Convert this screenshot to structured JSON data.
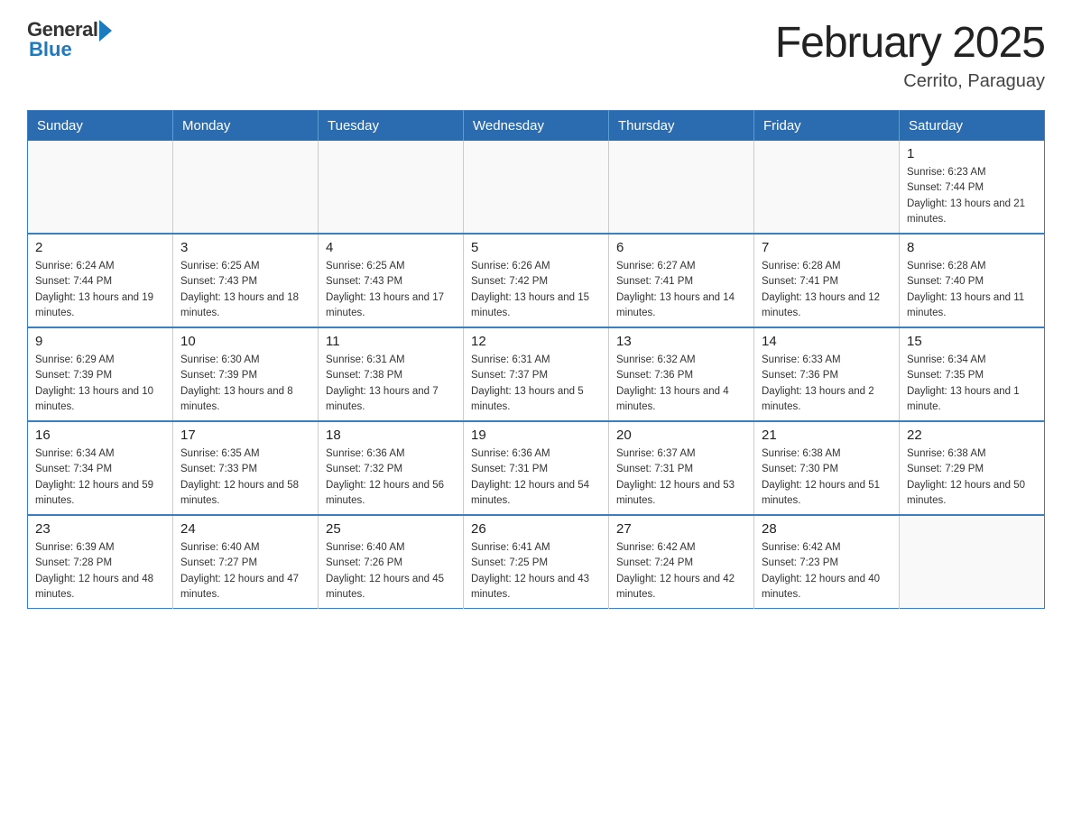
{
  "logo": {
    "general": "General",
    "blue": "Blue"
  },
  "title": "February 2025",
  "subtitle": "Cerrito, Paraguay",
  "days_of_week": [
    "Sunday",
    "Monday",
    "Tuesday",
    "Wednesday",
    "Thursday",
    "Friday",
    "Saturday"
  ],
  "weeks": [
    {
      "days": [
        {
          "num": "",
          "info": ""
        },
        {
          "num": "",
          "info": ""
        },
        {
          "num": "",
          "info": ""
        },
        {
          "num": "",
          "info": ""
        },
        {
          "num": "",
          "info": ""
        },
        {
          "num": "",
          "info": ""
        },
        {
          "num": "1",
          "info": "Sunrise: 6:23 AM\nSunset: 7:44 PM\nDaylight: 13 hours and 21 minutes."
        }
      ]
    },
    {
      "days": [
        {
          "num": "2",
          "info": "Sunrise: 6:24 AM\nSunset: 7:44 PM\nDaylight: 13 hours and 19 minutes."
        },
        {
          "num": "3",
          "info": "Sunrise: 6:25 AM\nSunset: 7:43 PM\nDaylight: 13 hours and 18 minutes."
        },
        {
          "num": "4",
          "info": "Sunrise: 6:25 AM\nSunset: 7:43 PM\nDaylight: 13 hours and 17 minutes."
        },
        {
          "num": "5",
          "info": "Sunrise: 6:26 AM\nSunset: 7:42 PM\nDaylight: 13 hours and 15 minutes."
        },
        {
          "num": "6",
          "info": "Sunrise: 6:27 AM\nSunset: 7:41 PM\nDaylight: 13 hours and 14 minutes."
        },
        {
          "num": "7",
          "info": "Sunrise: 6:28 AM\nSunset: 7:41 PM\nDaylight: 13 hours and 12 minutes."
        },
        {
          "num": "8",
          "info": "Sunrise: 6:28 AM\nSunset: 7:40 PM\nDaylight: 13 hours and 11 minutes."
        }
      ]
    },
    {
      "days": [
        {
          "num": "9",
          "info": "Sunrise: 6:29 AM\nSunset: 7:39 PM\nDaylight: 13 hours and 10 minutes."
        },
        {
          "num": "10",
          "info": "Sunrise: 6:30 AM\nSunset: 7:39 PM\nDaylight: 13 hours and 8 minutes."
        },
        {
          "num": "11",
          "info": "Sunrise: 6:31 AM\nSunset: 7:38 PM\nDaylight: 13 hours and 7 minutes."
        },
        {
          "num": "12",
          "info": "Sunrise: 6:31 AM\nSunset: 7:37 PM\nDaylight: 13 hours and 5 minutes."
        },
        {
          "num": "13",
          "info": "Sunrise: 6:32 AM\nSunset: 7:36 PM\nDaylight: 13 hours and 4 minutes."
        },
        {
          "num": "14",
          "info": "Sunrise: 6:33 AM\nSunset: 7:36 PM\nDaylight: 13 hours and 2 minutes."
        },
        {
          "num": "15",
          "info": "Sunrise: 6:34 AM\nSunset: 7:35 PM\nDaylight: 13 hours and 1 minute."
        }
      ]
    },
    {
      "days": [
        {
          "num": "16",
          "info": "Sunrise: 6:34 AM\nSunset: 7:34 PM\nDaylight: 12 hours and 59 minutes."
        },
        {
          "num": "17",
          "info": "Sunrise: 6:35 AM\nSunset: 7:33 PM\nDaylight: 12 hours and 58 minutes."
        },
        {
          "num": "18",
          "info": "Sunrise: 6:36 AM\nSunset: 7:32 PM\nDaylight: 12 hours and 56 minutes."
        },
        {
          "num": "19",
          "info": "Sunrise: 6:36 AM\nSunset: 7:31 PM\nDaylight: 12 hours and 54 minutes."
        },
        {
          "num": "20",
          "info": "Sunrise: 6:37 AM\nSunset: 7:31 PM\nDaylight: 12 hours and 53 minutes."
        },
        {
          "num": "21",
          "info": "Sunrise: 6:38 AM\nSunset: 7:30 PM\nDaylight: 12 hours and 51 minutes."
        },
        {
          "num": "22",
          "info": "Sunrise: 6:38 AM\nSunset: 7:29 PM\nDaylight: 12 hours and 50 minutes."
        }
      ]
    },
    {
      "days": [
        {
          "num": "23",
          "info": "Sunrise: 6:39 AM\nSunset: 7:28 PM\nDaylight: 12 hours and 48 minutes."
        },
        {
          "num": "24",
          "info": "Sunrise: 6:40 AM\nSunset: 7:27 PM\nDaylight: 12 hours and 47 minutes."
        },
        {
          "num": "25",
          "info": "Sunrise: 6:40 AM\nSunset: 7:26 PM\nDaylight: 12 hours and 45 minutes."
        },
        {
          "num": "26",
          "info": "Sunrise: 6:41 AM\nSunset: 7:25 PM\nDaylight: 12 hours and 43 minutes."
        },
        {
          "num": "27",
          "info": "Sunrise: 6:42 AM\nSunset: 7:24 PM\nDaylight: 12 hours and 42 minutes."
        },
        {
          "num": "28",
          "info": "Sunrise: 6:42 AM\nSunset: 7:23 PM\nDaylight: 12 hours and 40 minutes."
        },
        {
          "num": "",
          "info": ""
        }
      ]
    }
  ]
}
